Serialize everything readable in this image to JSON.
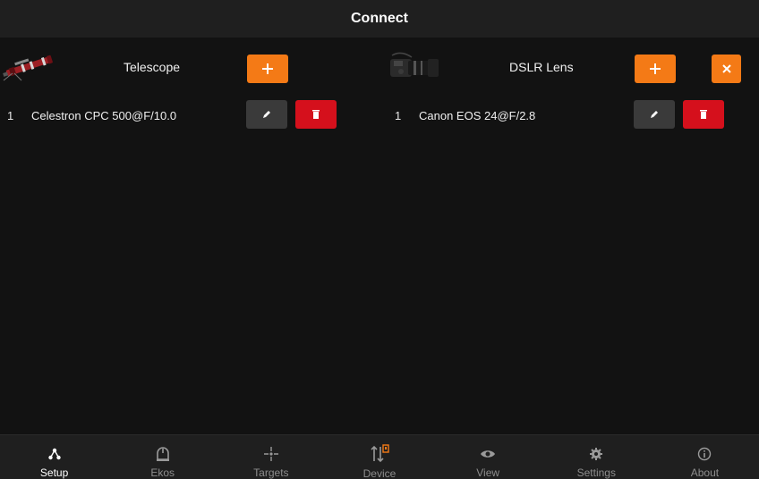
{
  "header": {
    "title": "Connect"
  },
  "telescope_panel": {
    "title": "Telescope",
    "image": "telescope-image",
    "rows": [
      {
        "index": "1",
        "name": "Celestron CPC 500@F/10.0"
      }
    ]
  },
  "lens_panel": {
    "title": "DSLR Lens",
    "image": "dslr-camera-image",
    "rows": [
      {
        "index": "1",
        "name": "Canon EOS 24@F/2.8"
      }
    ]
  },
  "icons": {
    "add": "plus-icon",
    "edit": "pencil-icon",
    "delete": "trash-icon",
    "close": "close-icon"
  },
  "colors": {
    "accent": "#f47a16",
    "danger": "#d5101c",
    "background": "#121212",
    "bar": "#1f1f1f"
  },
  "nav": {
    "active": "Setup",
    "items": [
      {
        "label": "Setup",
        "icon": "setup-icon"
      },
      {
        "label": "Ekos",
        "icon": "ekos-icon"
      },
      {
        "label": "Targets",
        "icon": "targets-icon"
      },
      {
        "label": "Device",
        "icon": "device-icon"
      },
      {
        "label": "View",
        "icon": "eye-icon"
      },
      {
        "label": "Settings",
        "icon": "gear-icon"
      },
      {
        "label": "About",
        "icon": "info-icon"
      }
    ]
  }
}
